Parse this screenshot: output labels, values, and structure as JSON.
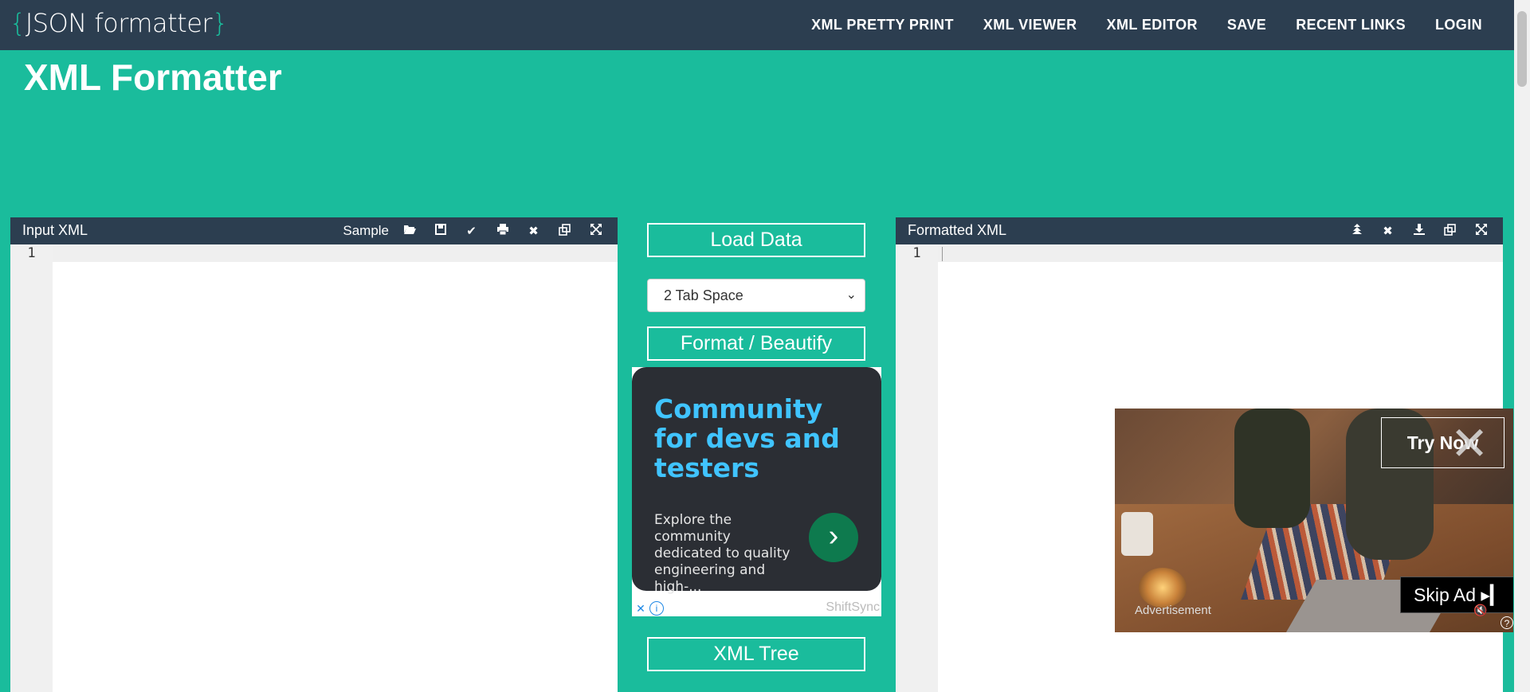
{
  "header": {
    "logo_open": "{",
    "logo_text": "JSON formatter",
    "logo_close": "}",
    "nav": [
      "XML PRETTY PRINT",
      "XML VIEWER",
      "XML EDITOR",
      "SAVE",
      "RECENT LINKS",
      "LOGIN"
    ]
  },
  "page": {
    "title": "XML Formatter"
  },
  "input_panel": {
    "title": "Input XML",
    "sample_label": "Sample",
    "line_number": "1"
  },
  "output_panel": {
    "title": "Formatted XML",
    "line_number": "1"
  },
  "controls": {
    "load_data": "Load Data",
    "indent_value": "2 Tab Space",
    "format": "Format / Beautify",
    "tree": "XML Tree"
  },
  "ad": {
    "headline": "Community for devs and testers",
    "body": "Explore the community dedicated to quality engineering and high-...",
    "brand": "ShiftSync"
  },
  "video_ad": {
    "try_now": "Try Now",
    "skip": "Skip Ad ▸▎",
    "label": "Advertisement"
  },
  "colors": {
    "accent": "#1abc9c",
    "dark": "#2c3e50"
  }
}
